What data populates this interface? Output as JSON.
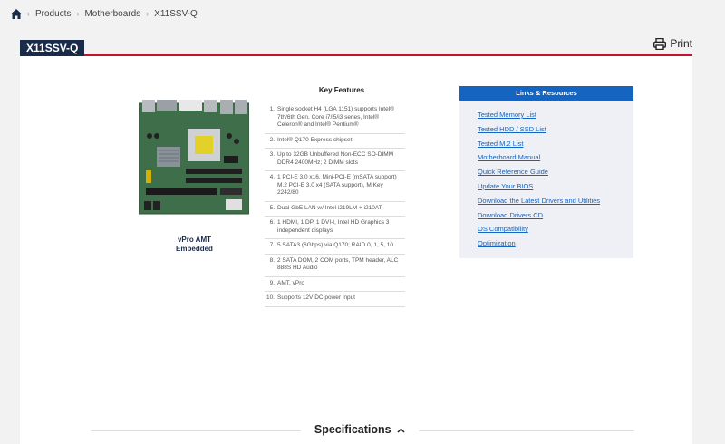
{
  "breadcrumb": {
    "home_icon": "home-icon",
    "items": [
      "Products",
      "Motherboards",
      "X11SSV-Q"
    ]
  },
  "header": {
    "title": "X11SSV-Q",
    "print_label": "Print",
    "accent_color": "#c8102e",
    "title_bg": "#1a2b4a"
  },
  "product": {
    "caption_line1": "vPro AMT",
    "caption_line2": "Embedded"
  },
  "features": {
    "title": "Key Features",
    "items": [
      {
        "num": "1.",
        "text": "Single socket H4 (LGA 1151) supports Intel® 7th/6th Gen. Core i7/i5/i3 series, Intel® Celeron® and Intel® Pentium®"
      },
      {
        "num": "2.",
        "text": "Intel® Q170 Express chipset"
      },
      {
        "num": "3.",
        "text": "Up to 32GB Unbuffered Non-ECC SO-DIMM DDR4 2400MHz; 2 DIMM slots"
      },
      {
        "num": "4.",
        "text": "1 PCI-E 3.0 x16, Mini-PCI-E (mSATA support) M.2 PCI-E 3.0 x4 (SATA support), M Key 2242/80"
      },
      {
        "num": "5.",
        "text": "Dual GbE LAN w/ Intel i219LM + i210AT"
      },
      {
        "num": "6.",
        "text": "1 HDMI, 1 DP, 1 DVI-I, Intel HD Graphics 3 independent displays"
      },
      {
        "num": "7.",
        "text": "5 SATA3 (6Gbps) via Q170; RAID 0, 1, 5, 10"
      },
      {
        "num": "8.",
        "text": "2 SATA DOM, 2 COM ports, TPM header, ALC 888S HD Audio"
      },
      {
        "num": "9.",
        "text": "AMT, vPro"
      },
      {
        "num": "10.",
        "text": "Supports 12V DC power input"
      }
    ]
  },
  "links": {
    "title": "Links & Resources",
    "items": [
      "Tested Memory List",
      "Tested HDD / SSD List",
      "Tested M.2 List",
      "Motherboard Manual",
      "Quick Reference Guide",
      "Update Your BIOS",
      "Download the Latest Drivers and Utilities",
      "Download Drivers CD",
      "OS Compatibility",
      "Optimization"
    ]
  },
  "specifications": {
    "title": "Specifications",
    "toggle_icon": "chevron-up-icon"
  }
}
